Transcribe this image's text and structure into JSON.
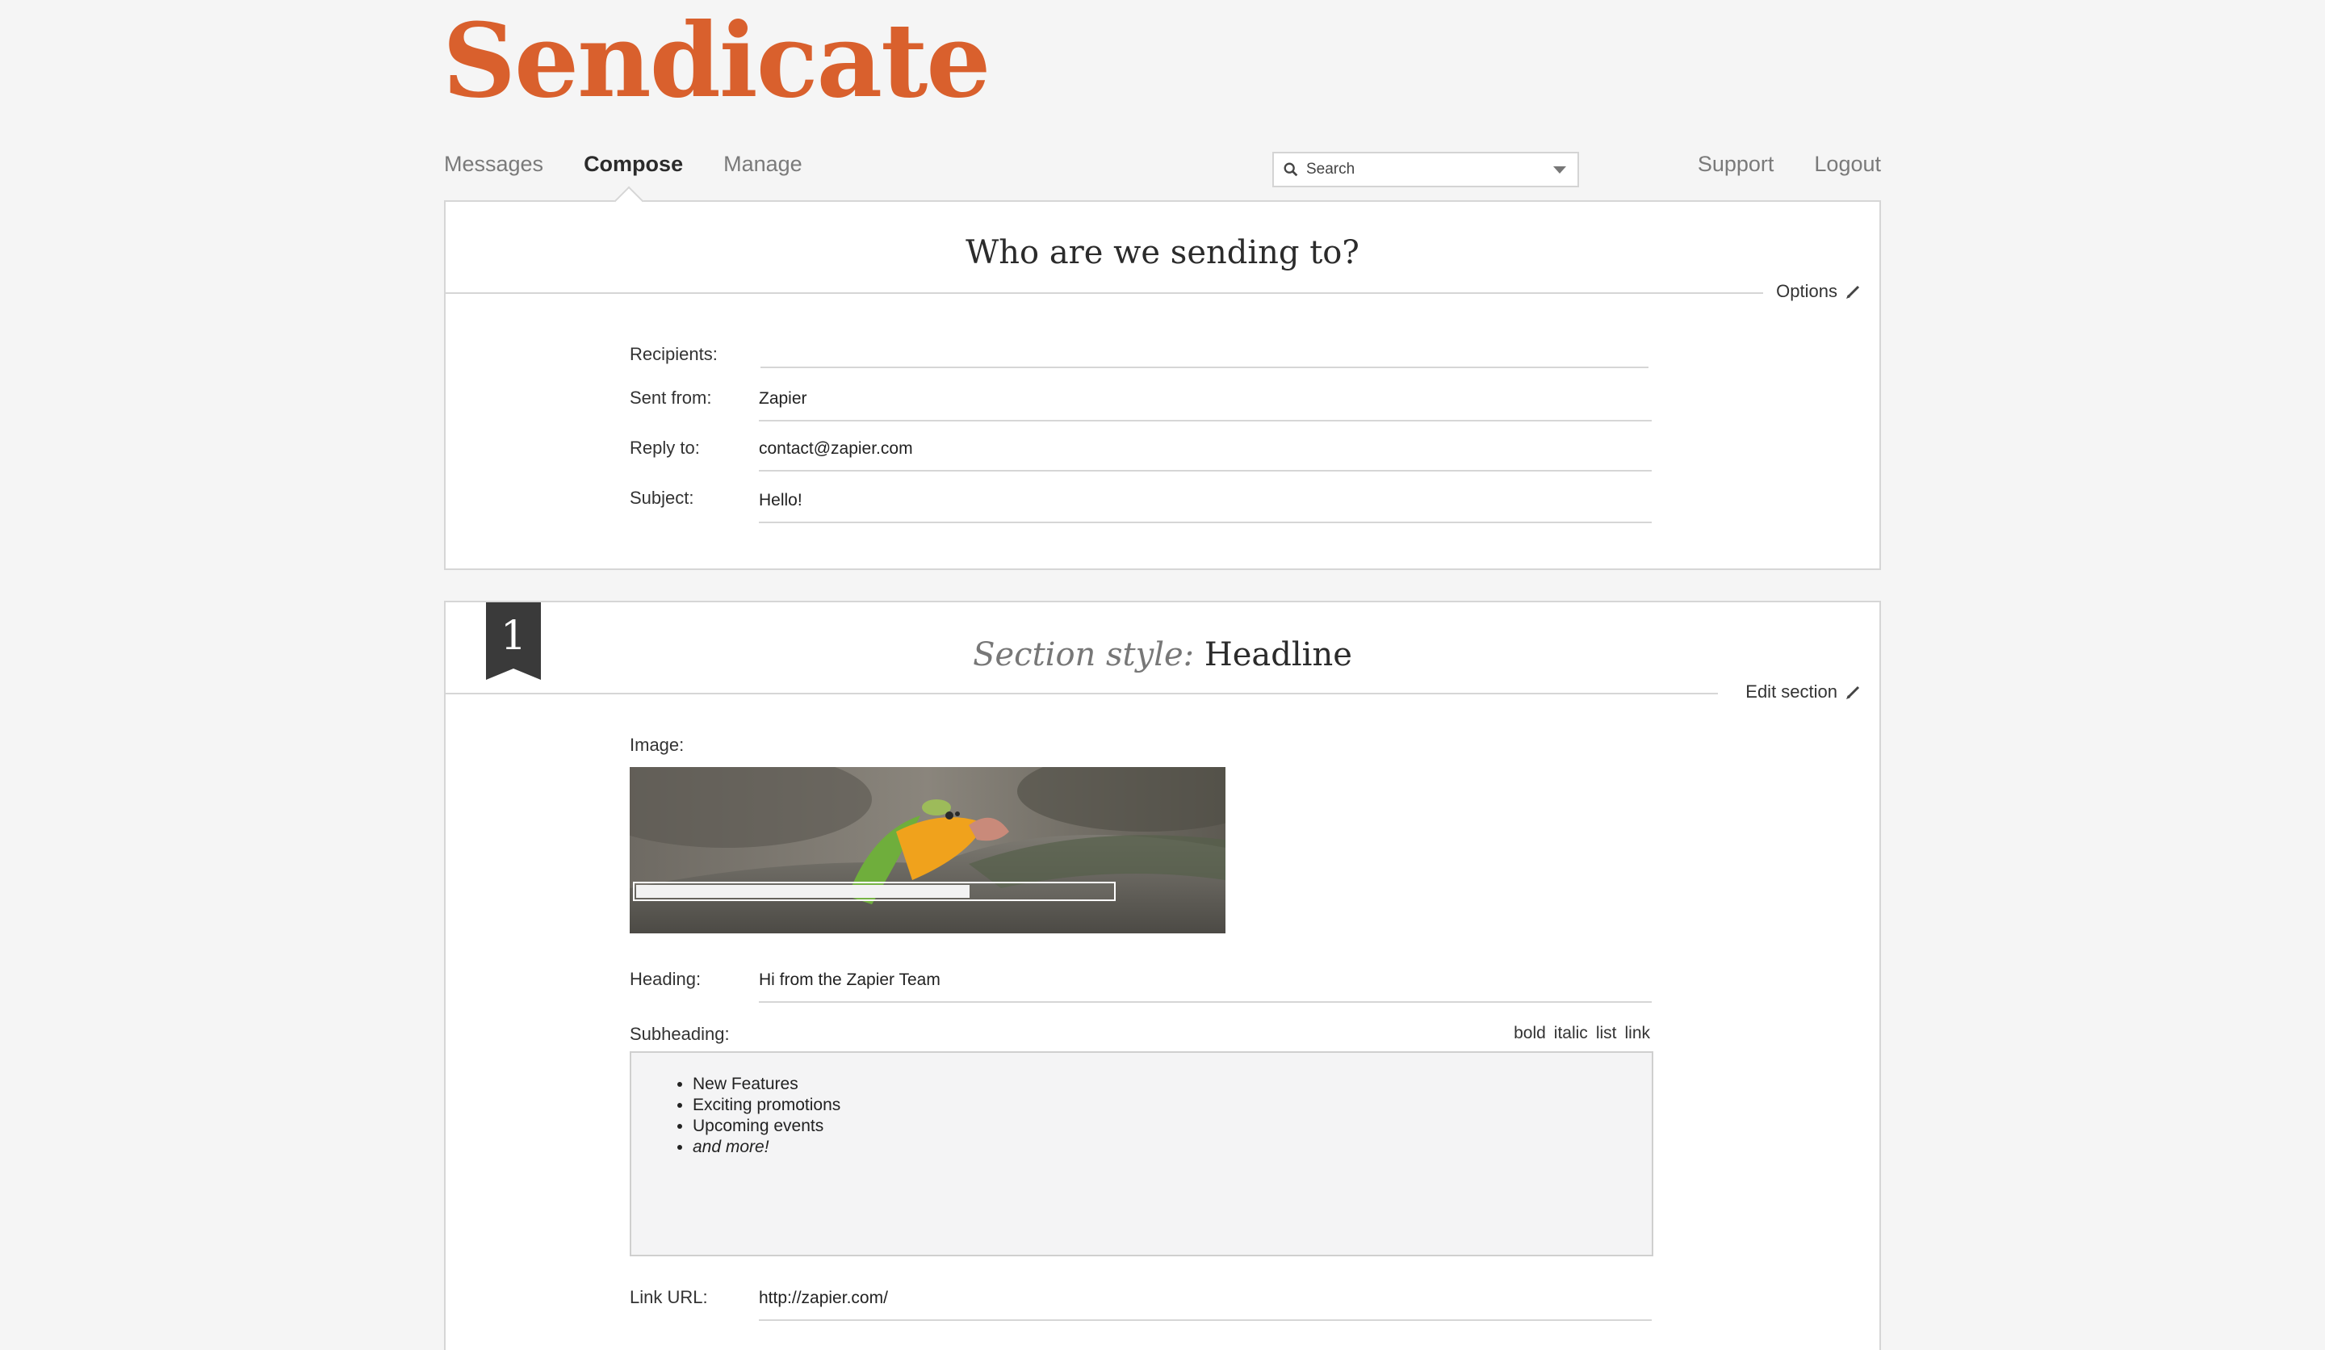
{
  "brand": {
    "name": "Sendicate",
    "color": "#d9602d"
  },
  "nav": {
    "items": [
      {
        "label": "Messages"
      },
      {
        "label": "Compose"
      },
      {
        "label": "Manage"
      }
    ],
    "active": "Compose"
  },
  "search": {
    "placeholder": "Search"
  },
  "rightnav": {
    "support": "Support",
    "logout": "Logout"
  },
  "recipients_panel": {
    "title": "Who are we sending to?",
    "options_label": "Options",
    "fields": {
      "recipients": {
        "label": "Recipients:",
        "value": ""
      },
      "sent_from": {
        "label": "Sent from:",
        "value": "Zapier"
      },
      "reply_to": {
        "label": "Reply to:",
        "value": "contact@zapier.com"
      },
      "subject": {
        "label": "Subject:",
        "value": "Hello!"
      }
    }
  },
  "section_panel": {
    "number": "1",
    "style_prefix": "Section style:",
    "style_name": "Headline",
    "edit_label": "Edit section",
    "image_label": "Image:",
    "upload_progress": 0.7,
    "heading": {
      "label": "Heading:",
      "value": "Hi from the Zapier Team"
    },
    "subheading": {
      "label": "Subheading:",
      "tools": {
        "bold": "bold",
        "italic": "italic",
        "list": "list",
        "link": "link"
      },
      "items": [
        "New Features",
        "Exciting promotions",
        "Upcoming events",
        "and more!"
      ]
    },
    "link_url": {
      "label": "Link URL:",
      "value": "http://zapier.com/"
    }
  }
}
